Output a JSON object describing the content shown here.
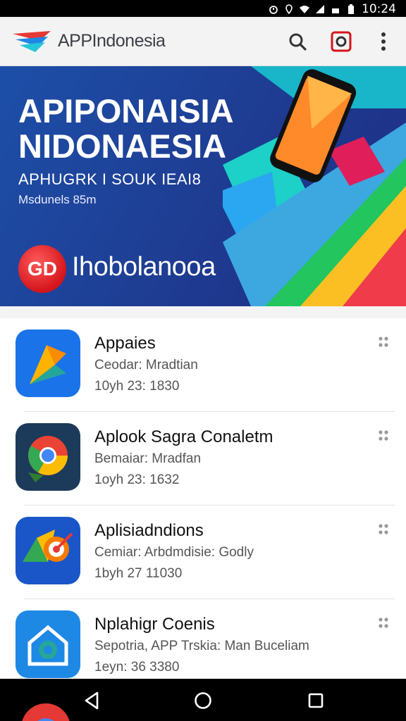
{
  "status_bar": {
    "time": "10:24",
    "icons": [
      "alarm-icon",
      "location-icon",
      "wifi-icon",
      "signal-icon",
      "battery-icon"
    ]
  },
  "app_bar": {
    "title": "APPIndonesia",
    "actions": [
      "search-icon",
      "record-icon",
      "more-vert-icon"
    ]
  },
  "banner": {
    "headline_1": "APIPONAISIA",
    "headline_2": "NIDONAESIA",
    "subtitle": "APHUGRK I SOUK IEAI8",
    "tagline": "Msdunels 85m",
    "badge": "GD",
    "brand": "Ihobolanooa"
  },
  "apps": [
    {
      "title": "Appaies",
      "subtitle": "Ceodar: Mradtian",
      "meta": "10yh 23: 1830",
      "icon": "app-arrow-icon"
    },
    {
      "title": "Aplook Sagra Conaletm",
      "subtitle": "Bemaiar: Mradfan",
      "meta": "1oyh 23: 1632",
      "icon": "app-chrome-icon"
    },
    {
      "title": "Aplisiadndions",
      "subtitle": "Cemiar: Arbdmdisie: Godly",
      "meta": "1byh 27 11030",
      "icon": "app-target-icon"
    },
    {
      "title": "Nplahigr Coenis",
      "subtitle": "Sepotria, APP Trskia: Man Buceliam",
      "meta": "1eyn: 36 3380",
      "icon": "app-home-icon"
    }
  ],
  "nav": {
    "buttons": [
      "back-icon",
      "home-icon",
      "recents-icon"
    ]
  },
  "colors": {
    "accent_red": "#d4151b",
    "banner_blue": "#1e3f95",
    "text_dark": "#111111"
  }
}
